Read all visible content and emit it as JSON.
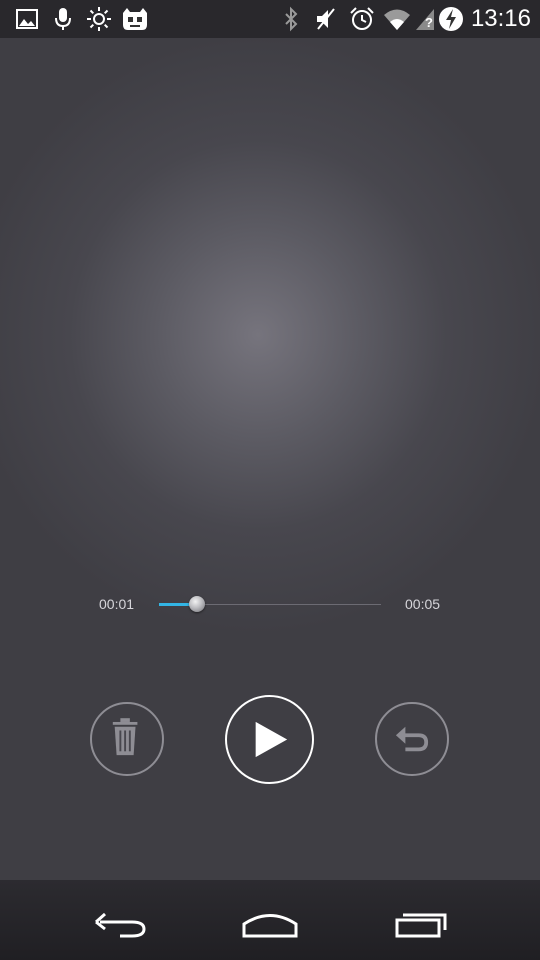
{
  "status_bar": {
    "time": "13:16",
    "left_icons": [
      "gallery-icon",
      "microphone-icon",
      "brightness-icon",
      "cyanogenmod-icon"
    ],
    "right_icons": [
      "bluetooth-icon",
      "mute-icon",
      "alarm-icon",
      "wifi-icon",
      "no-signal-icon",
      "battery-charging-icon"
    ]
  },
  "player": {
    "elapsed": "00:01",
    "total": "00:05",
    "progress": 0.17,
    "accent_color": "#33b5e5"
  },
  "controls": {
    "delete_icon": "trash-icon",
    "play_icon": "play-icon",
    "undo_icon": "undo-icon"
  },
  "nav_bar": {
    "back_icon": "back-icon",
    "home_icon": "home-icon",
    "recents_icon": "recents-icon"
  }
}
